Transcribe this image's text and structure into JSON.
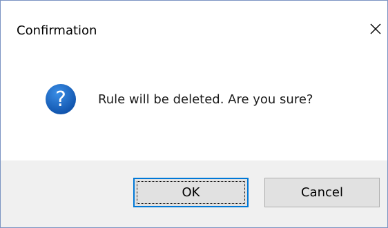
{
  "window": {
    "title": "Confirmation",
    "close_icon": "close-icon"
  },
  "message": {
    "icon": "question-icon",
    "icon_color": "#1565c0",
    "icon_glyph": "?",
    "text": "Rule will be deleted. Are you sure?"
  },
  "buttons": {
    "ok_label": "OK",
    "cancel_label": "Cancel",
    "focused": "OK",
    "accent": "#0078d7"
  }
}
